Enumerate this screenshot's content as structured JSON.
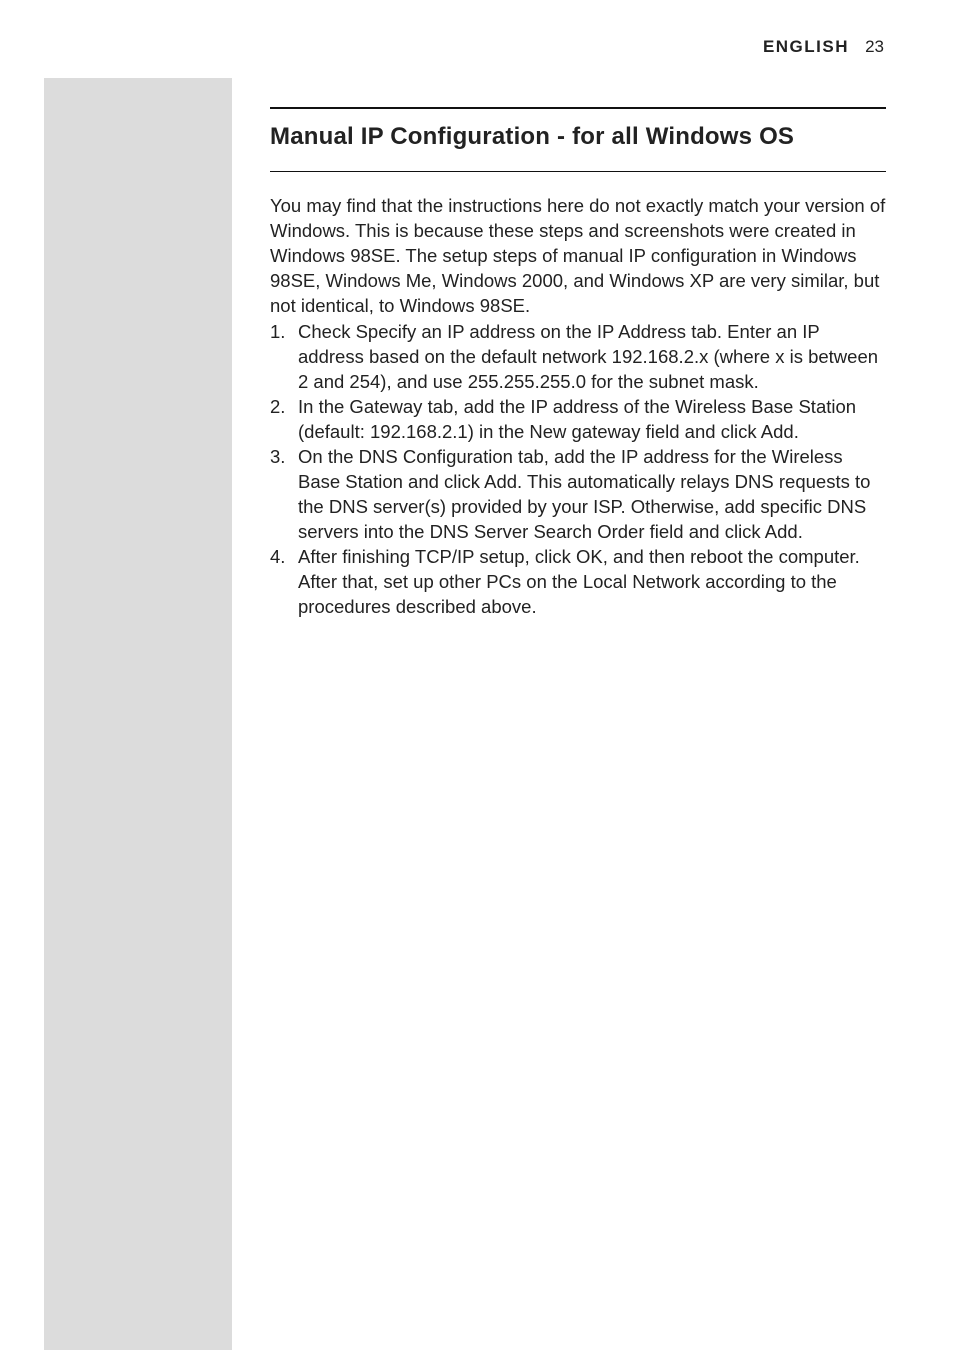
{
  "header": {
    "language": "ENGLISH",
    "pageNumber": "23"
  },
  "section": {
    "title": "Manual IP Configuration - for all Windows OS",
    "intro": "You may find that the instructions here do not exactly match your version of Windows. This is because these steps and screenshots were created in Windows 98SE. The setup steps of manual IP configuration in Windows 98SE, Windows Me, Windows 2000, and Windows XP are very similar, but not identical, to Windows 98SE.",
    "steps": [
      {
        "num": "1.",
        "text": "Check Specify an IP address on the IP Address tab. Enter an IP address based on the default network 192.168.2.x (where x is between 2 and 254), and use 255.255.255.0 for the subnet mask."
      },
      {
        "num": "2.",
        "text": "In the Gateway tab, add the IP address of the Wireless Base Station (default: 192.168.2.1) in the New gateway field and click Add."
      },
      {
        "num": "3.",
        "text": "On the DNS Configuration tab, add the IP address for the Wireless Base Station and click Add. This automatically relays DNS requests to the DNS server(s) provided by your ISP. Otherwise, add specific DNS servers into the DNS Server Search Order field and click Add."
      },
      {
        "num": "4.",
        "text": "After finishing TCP/IP setup, click OK, and then reboot the computer. After that, set up other PCs on the Local Network according to the procedures described above."
      }
    ]
  }
}
